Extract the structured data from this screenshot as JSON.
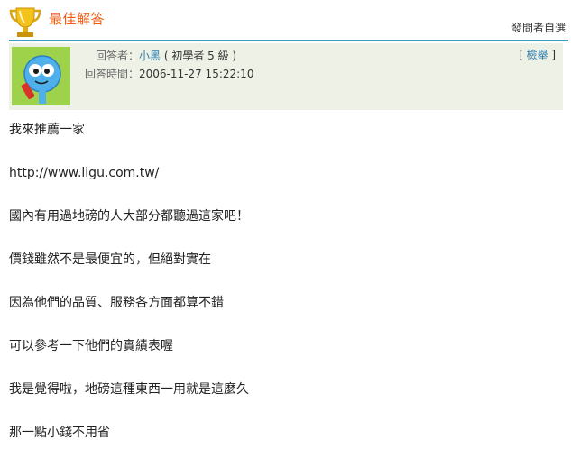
{
  "header": {
    "title": "最佳解答",
    "right_text": "發問者自選",
    "accent_color": "#ee5a10",
    "rule_color": "#3aa0c8",
    "trophy_icon": "trophy-icon"
  },
  "answer": {
    "responder_label": "回答者：",
    "responder_name": "小黑",
    "responder_level": " ( 初學者 5 級 )",
    "time_label": "回答時間：",
    "time_value": "2006-11-27 15:22:10",
    "report_open": "[ ",
    "report_label": "檢舉",
    "report_close": " ]",
    "avatar_icon": "avatar-icon",
    "box_color": "#eef1e6"
  },
  "content": {
    "lines": [
      "我來推薦一家",
      "http://www.ligu.com.tw/",
      "國內有用過地磅的人大部分都聽過這家吧！",
      "價錢雖然不是最便宜的，但絕對實在",
      "因為他們的品質、服務各方面都算不錯",
      "可以參考一下他們的實績表喔",
      "我是覺得啦，地磅這種東西一用就是這麼久",
      "那一點小錢不用省"
    ]
  }
}
